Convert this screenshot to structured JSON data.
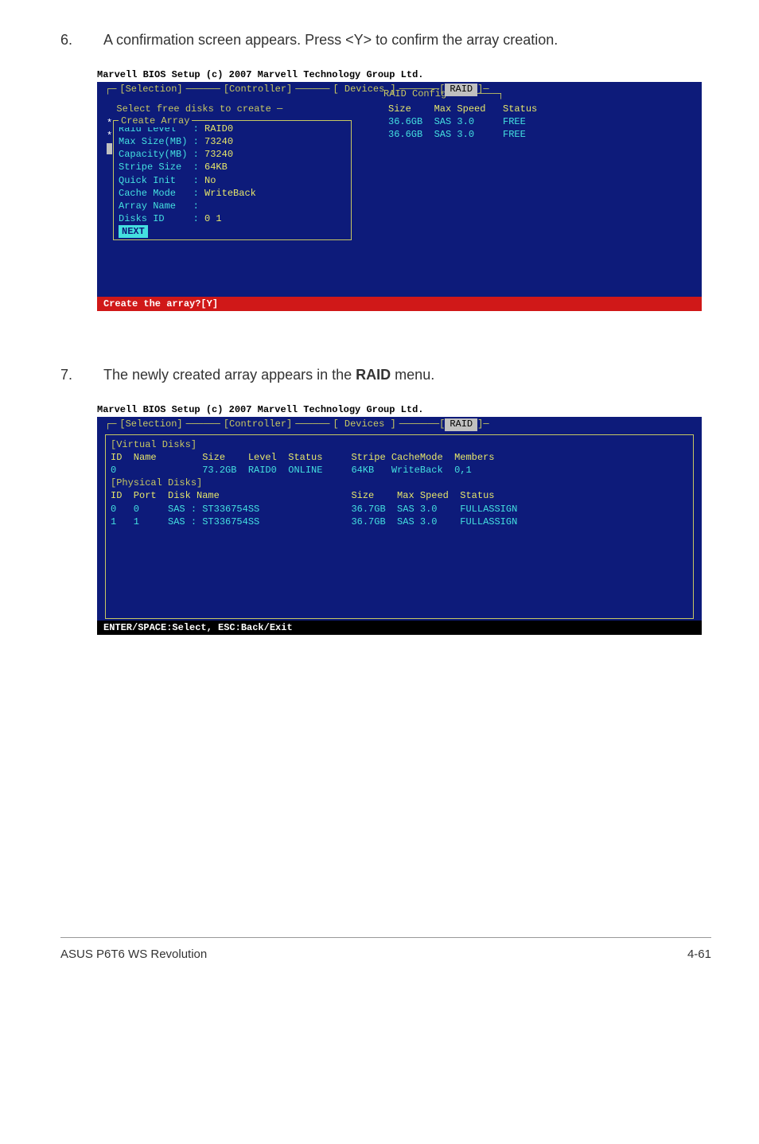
{
  "step6": {
    "num": "6.",
    "text_a": "A confirmation screen appears. Press <Y> to confirm the array creation."
  },
  "bios1": {
    "title": "Marvell BIOS Setup (c) 2007 Marvell Technology Group Ltd.",
    "tabs": {
      "selection": "[Selection]",
      "controller": "[Controller]",
      "devices": "[ Devices ]",
      "raid": "  RAID  "
    },
    "raid_config": "RAID Config",
    "select_free": "Select free disks to create",
    "create_array": "Create Array",
    "fields": {
      "raid_level_k": "Raid Level   :",
      "raid_level_v": "RAID0",
      "max_size_k": "Max Size(MB) :",
      "max_size_v": "73240",
      "capacity_k": "Capacity(MB) :",
      "capacity_v": "73240",
      "stripe_k": "Stripe Size  :",
      "stripe_v": "64KB",
      "quick_k": "Quick Init   :",
      "quick_v": "No",
      "cache_k": "Cache Mode   :",
      "cache_v": "WriteBack",
      "arrayname_k": "Array Name   :",
      "arrayname_v": "",
      "disksid_k": "Disks ID     :",
      "disksid_v": "0 1",
      "next": "NEXT"
    },
    "right_head": "Size    Max Speed   Status",
    "right_r1": "36.6GB  SAS 3.0     FREE",
    "right_r2": "36.6GB  SAS 3.0     FREE",
    "confirm": "Create the array?[Y]"
  },
  "step7": {
    "num": "7.",
    "text_a": "The newly created array appears in the ",
    "text_b": "RAID",
    "text_c": " menu."
  },
  "bios2": {
    "title": "Marvell BIOS Setup (c) 2007 Marvell Technology Group Ltd.",
    "tabs": {
      "selection": "[Selection]",
      "controller": "[Controller]",
      "devices": "[ Devices ]",
      "raid": "  RAID  "
    },
    "vdisks": "[Virtual Disks]",
    "v_head": "ID  Name        Size    Level  Status     Stripe CacheMode  Members",
    "v_r1": "0               73.2GB  RAID0  ONLINE     64KB   WriteBack  0,1",
    "pdisks": "[Physical Disks]",
    "p_head": "ID  Port  Disk Name                       Size    Max Speed  Status",
    "p_r1": "0   0     SAS : ST336754SS                36.7GB  SAS 3.0    FULLASSIGN",
    "p_r2": "1   1     SAS : ST336754SS                36.7GB  SAS 3.0    FULLASSIGN",
    "footer_bar": "ENTER/SPACE:Select, ESC:Back/Exit"
  },
  "footer": {
    "left": "ASUS P6T6 WS Revolution",
    "right": "4-61"
  }
}
